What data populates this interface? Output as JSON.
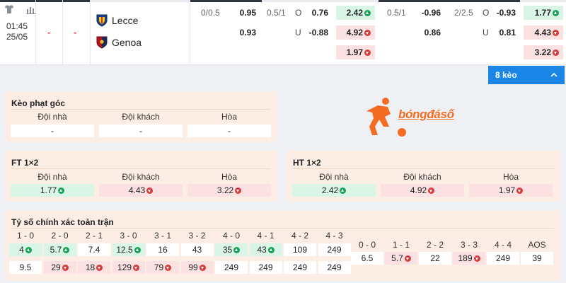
{
  "match": {
    "time": "01:45",
    "date": "25/05",
    "score_home": "-",
    "score_away": "-",
    "home_team": "Lecce",
    "away_team": "Genoa",
    "home_crest_icon": "lecce-crest-icon",
    "away_crest_icon": "genoa-crest-icon",
    "row1": {
      "ah_ft_line": "0/0.5",
      "ah_ft_home": "0.95",
      "ou_ft_line": "0.5/1",
      "ou_ft_tag": "O",
      "ou_ft_over": "0.76",
      "x12_ft_home": "2.42",
      "ah_ht_line": "0.5/1",
      "ah_ht_home": "-0.96",
      "ou_ht_line": "2/2.5",
      "ou_ht_tag": "O",
      "ou_ht_over": "-0.93",
      "x12_ht_home": "1.77"
    },
    "row2": {
      "ah_ft_away": "0.93",
      "ou_ft_tag": "U",
      "ou_ft_under": "-0.88",
      "x12_ft_away": "4.92",
      "ah_ht_away": "0.86",
      "ou_ht_tag": "U",
      "ou_ht_under": "0.81",
      "x12_ht_away": "4.43"
    },
    "row3": {
      "x12_ft_draw": "1.97",
      "x12_ht_draw": "3.22"
    }
  },
  "toolbar": {
    "shirt_icon": "shirt-icon",
    "stats_icon": "bar-chart-icon",
    "keo_button_label": "8 kèo",
    "chevron_icon": "chevron-up-icon"
  },
  "corner": {
    "title": "Kèo phạt góc",
    "col_home": "Đội nhà",
    "col_away": "Đội khách",
    "col_draw": "Hòa",
    "val_home": "-",
    "val_away": "-",
    "val_draw": "-"
  },
  "logo": {
    "text": "bóngđásố"
  },
  "ft12": {
    "title": "FT 1×2",
    "col_home": "Đội nhà",
    "col_away": "Đội khách",
    "col_draw": "Hòa",
    "val_home": "1.77",
    "val_away": "4.43",
    "val_draw": "3.22"
  },
  "ht12": {
    "title": "HT 1×2",
    "col_home": "Đội nhà",
    "col_away": "Đội khách",
    "col_draw": "Hòa",
    "val_home": "2.42",
    "val_away": "4.92",
    "val_draw": "1.97"
  },
  "scores": {
    "title": "Tỷ số chính xác toàn trận",
    "home_wins": [
      {
        "label": "1 - 0",
        "home": "4",
        "home_dir": "up",
        "away": "9.5",
        "away_dir": ""
      },
      {
        "label": "2 - 0",
        "home": "5.7",
        "home_dir": "up",
        "away": "29",
        "away_dir": "down"
      },
      {
        "label": "2 - 1",
        "home": "7.4",
        "home_dir": "",
        "away": "18",
        "away_dir": "down"
      },
      {
        "label": "3 - 0",
        "home": "12.5",
        "home_dir": "up",
        "away": "129",
        "away_dir": "down"
      },
      {
        "label": "3 - 1",
        "home": "16",
        "home_dir": "",
        "away": "79",
        "away_dir": "down"
      },
      {
        "label": "3 - 2",
        "home": "43",
        "home_dir": "",
        "away": "99",
        "away_dir": "down"
      },
      {
        "label": "4 - 0",
        "home": "35",
        "home_dir": "up",
        "away": "249",
        "away_dir": ""
      },
      {
        "label": "4 - 1",
        "home": "43",
        "home_dir": "up",
        "away": "249",
        "away_dir": ""
      },
      {
        "label": "4 - 2",
        "home": "109",
        "home_dir": "",
        "away": "249",
        "away_dir": ""
      },
      {
        "label": "4 - 3",
        "home": "249",
        "home_dir": "",
        "away": "249",
        "away_dir": ""
      }
    ],
    "draws": [
      {
        "label": "0 - 0",
        "value": "6.5",
        "dir": ""
      },
      {
        "label": "1 - 1",
        "value": "5.7",
        "dir": "down"
      },
      {
        "label": "2 - 2",
        "value": "22",
        "dir": ""
      },
      {
        "label": "3 - 3",
        "value": "189",
        "dir": "down"
      },
      {
        "label": "4 - 4",
        "value": "249",
        "dir": ""
      },
      {
        "label": "AOS",
        "value": "39",
        "dir": ""
      }
    ]
  },
  "colors": {
    "accent_blue": "#1a86e8",
    "odds_up_bg": "#d9f5e6",
    "odds_down_bg": "#fbe1e1",
    "panel_bg": "#fdeee5",
    "brand_orange": "#f36c21"
  }
}
